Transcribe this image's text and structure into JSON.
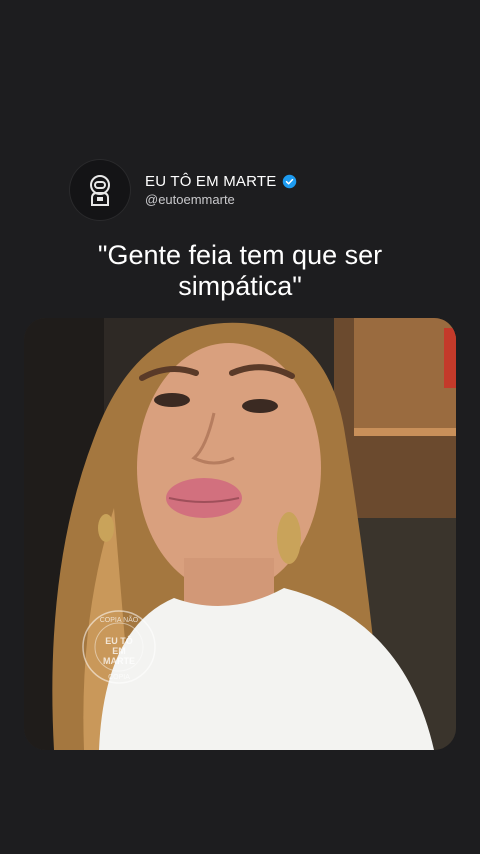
{
  "profile": {
    "display_name": "EU TÔ EM MARTE",
    "handle": "@eutoemmarte",
    "avatar_icon": "astronaut-icon",
    "verified_icon": "verified-badge-icon",
    "verified_color": "#1d9bf0"
  },
  "post": {
    "quote_line1": "\"Gente feia tem que ser",
    "quote_line2": "simpática\""
  },
  "media": {
    "type": "video-frame",
    "watermark_top": "COPIA NÃO",
    "watermark_center": "EU TÔ EM MARTE",
    "watermark_bottom": "COPIA"
  },
  "colors": {
    "background": "#1d1d1f",
    "text": "#ffffff",
    "subtext": "#c9c9cc"
  }
}
